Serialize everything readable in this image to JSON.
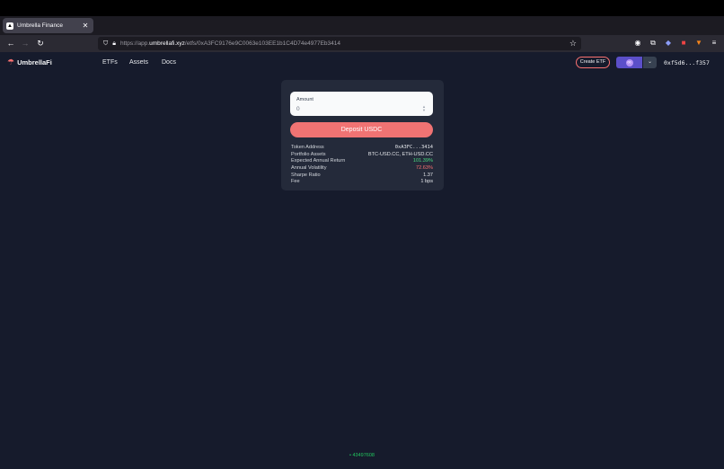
{
  "browser": {
    "tab_title": "Umbrella Finance",
    "tab_close": "✕",
    "new_tab": "+",
    "url_prefix": "https://app.",
    "url_domain": "umbrellafi.xyz",
    "url_path": "/etfs/0xA3FC9176e9C0063e103EE1b1C4D74e4977Eb3414"
  },
  "app": {
    "logo_text": "UmbrellaFi",
    "nav": [
      "ETFs",
      "Assets",
      "Docs"
    ],
    "create_button": "Create ETF",
    "wallet_address": "0xf5d6...f357",
    "chain_dropdown": "⌄"
  },
  "deposit": {
    "amount_label": "Amount",
    "amount_placeholder": "0",
    "button_label": "Deposit USDC"
  },
  "info_rows": [
    {
      "label": "Token Address",
      "value": "0xA3FC...3414"
    },
    {
      "label": "Portfolio Assets",
      "value": "BTC-USD.CC, ETH-USD.CC"
    },
    {
      "label": "Expected Annual Return",
      "value": "101.39%"
    },
    {
      "label": "Annual Volatility",
      "value": "72.63%"
    },
    {
      "label": "Sharpe Ratio",
      "value": "1.37"
    },
    {
      "label": "Fee",
      "value": "1 bps"
    }
  ],
  "footer": {
    "block": "• 43497608"
  },
  "colors": {
    "accent": "#f07373",
    "positive": "#4ade80",
    "negative": "#f87171",
    "background": "#161b2c",
    "card": "#242a3a"
  }
}
